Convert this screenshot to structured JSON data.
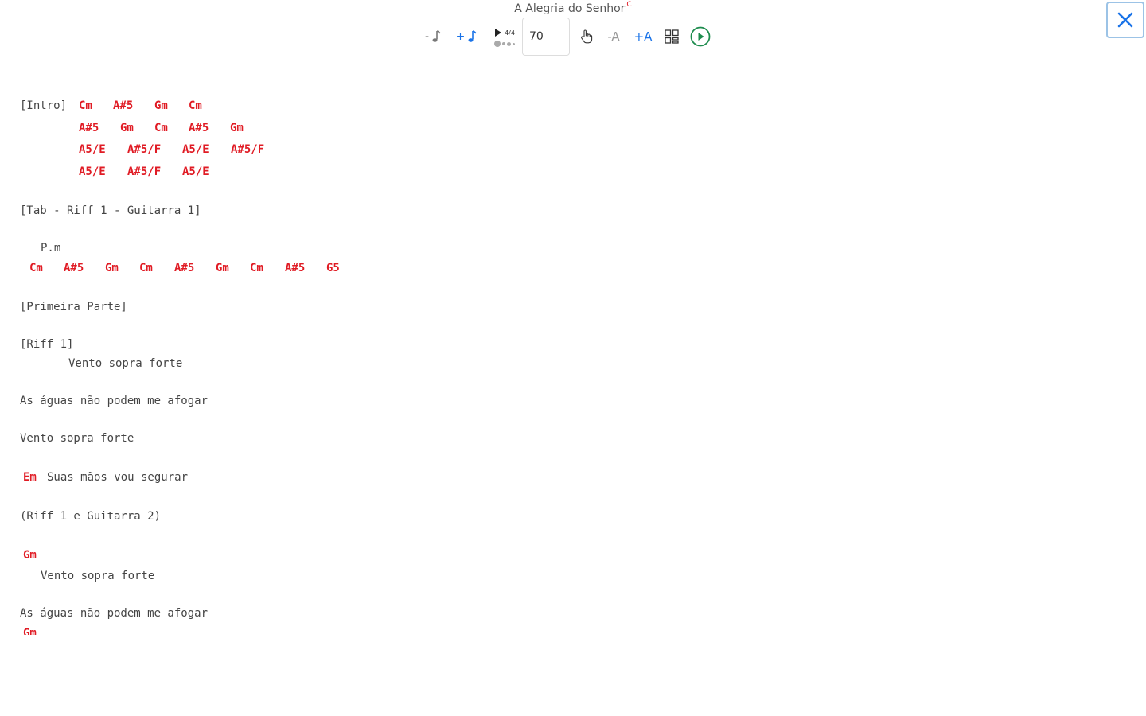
{
  "header": {
    "title": "A Alegria do Senhor",
    "key": "C"
  },
  "toolbar": {
    "speed_down_label": "-",
    "speed_up_label": "+",
    "time_signature": "4/4",
    "bpm_value": "70",
    "font_down_label": "-A",
    "font_up_label": "+A",
    "icons": {
      "speed_down": "music-note-icon",
      "speed_up": "music-note-icon",
      "metronome": "play-icon",
      "scroll": "hand-pointer-icon",
      "layout": "grid-layout-icon",
      "play": "play-circle-icon",
      "close": "close-icon"
    }
  },
  "colors": {
    "chord": "#e01b24",
    "accent": "#1a73e8",
    "play": "#1e8c4e",
    "text": "#444444"
  },
  "sheet": {
    "intro_label": "[Intro]",
    "intro_row1": [
      "Cm",
      "A#5",
      "Gm",
      "Cm"
    ],
    "intro_row2": [
      "A#5",
      "Gm",
      "Cm",
      "A#5",
      "Gm"
    ],
    "intro_row3": [
      "A5/E",
      "A#5/F",
      "A5/E",
      "A#5/F"
    ],
    "intro_row4": [
      "A5/E",
      "A#5/F",
      "A5/E"
    ],
    "tab_label": "[Tab - Riff 1 - Guitarra 1]",
    "pm": "P.m",
    "riff_chords": [
      "Cm",
      "A#5",
      "Gm",
      "Cm",
      "A#5",
      "Gm",
      "Cm",
      "A#5",
      "G5"
    ],
    "primeira_parte": "[Primeira Parte]",
    "riff1_label": "[Riff 1]",
    "lyric1": "Vento sopra forte",
    "lyric2": "As águas não podem me afogar",
    "lyric3": "Vento sopra forte",
    "em_chord": "Em",
    "lyric4": "Suas mãos vou segurar",
    "riff_guitarra2": "(Riff 1 e Guitarra 2)",
    "gm_chord1": "Gm",
    "lyric5": "Vento sopra forte",
    "lyric6": "As águas não podem me afogar",
    "gm_chord2": "Gm"
  }
}
